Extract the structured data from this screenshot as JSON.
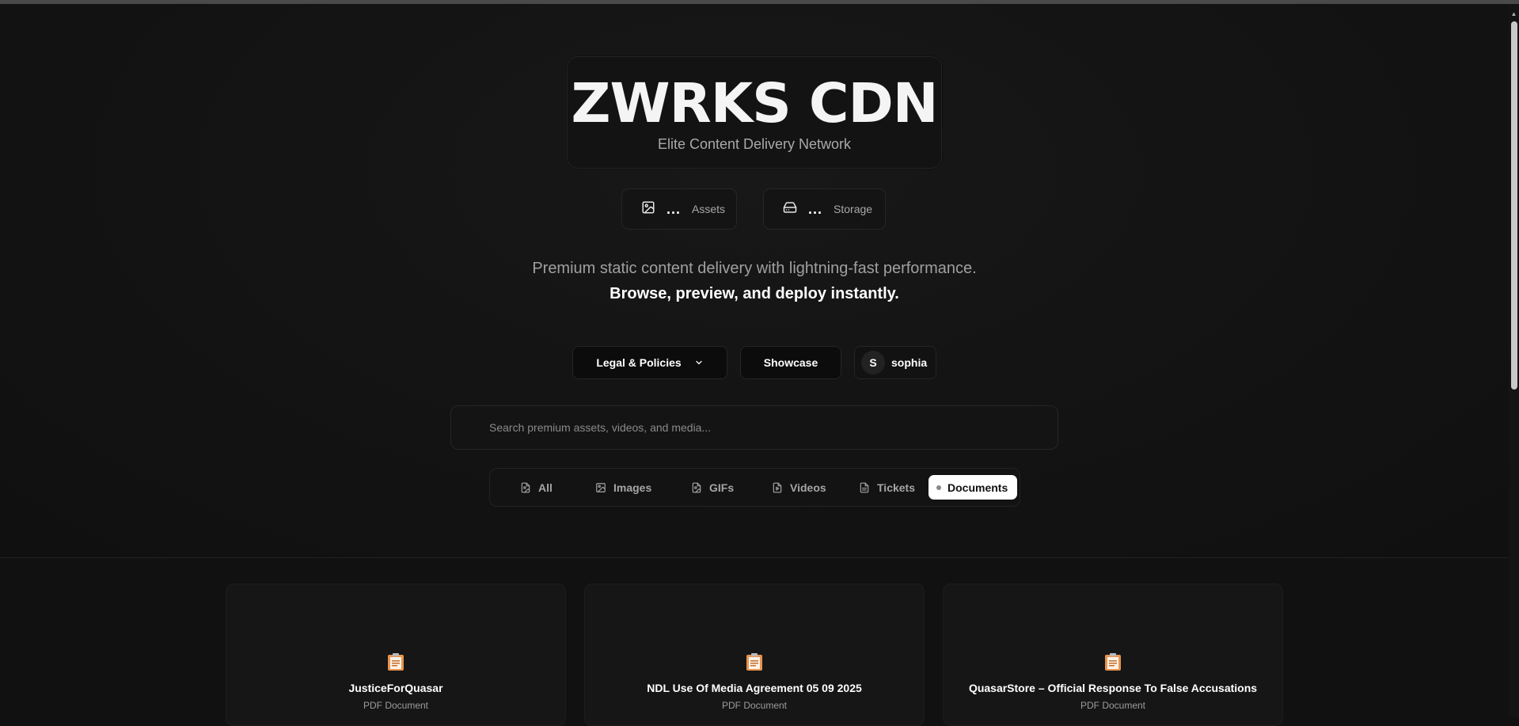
{
  "header": {
    "title": "ZWRKS CDN",
    "subtitle": "Elite Content Delivery Network"
  },
  "stats": [
    {
      "icon": "image-icon",
      "value": "...",
      "label": "Assets"
    },
    {
      "icon": "hard-drive-icon",
      "value": "...",
      "label": "Storage"
    }
  ],
  "tagline": {
    "line1": "Premium static content delivery with lightning-fast performance.",
    "line2": "Browse, preview, and deploy instantly."
  },
  "nav": {
    "legal_label": "Legal & Policies",
    "showcase_label": "Showcase",
    "user_initial": "S",
    "user_name": "sophia"
  },
  "search": {
    "placeholder": "Search premium assets, videos, and media...",
    "value": ""
  },
  "filters": [
    {
      "label": "All",
      "icon": "file-image-icon",
      "active": false
    },
    {
      "label": "Images",
      "icon": "image-icon",
      "active": false
    },
    {
      "label": "GIFs",
      "icon": "file-image-icon",
      "active": false
    },
    {
      "label": "Videos",
      "icon": "file-video-icon",
      "active": false
    },
    {
      "label": "Tickets",
      "icon": "file-text-icon",
      "active": false
    },
    {
      "label": "Documents",
      "icon": "dot-icon",
      "active": true
    }
  ],
  "documents": [
    {
      "name": "JusticeForQuasar",
      "type": "PDF Document",
      "icon": "clipboard-document-icon"
    },
    {
      "name": "NDL Use Of Media Agreement 05 09 2025",
      "type": "PDF Document",
      "icon": "clipboard-document-icon"
    },
    {
      "name": "QuasarStore – Official Response To False Accusations",
      "type": "PDF Document",
      "icon": "clipboard-document-icon"
    }
  ],
  "colors": {
    "background": "#111111",
    "card": "#161616",
    "active_chip": "#ffffff",
    "muted_text": "#a0a0a0",
    "doc_icon": "#e8944f"
  }
}
